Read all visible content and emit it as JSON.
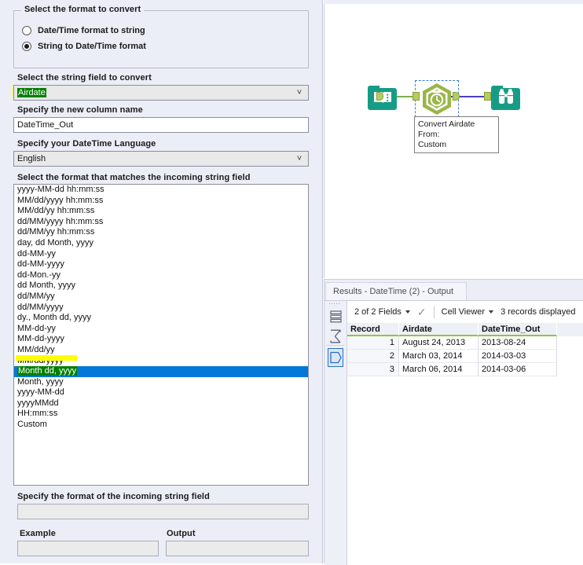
{
  "config_panel": {
    "format_group": {
      "title": "Select the format to convert",
      "options": [
        {
          "label": "Date/Time format to string",
          "checked": false
        },
        {
          "label": "String to Date/Time format",
          "checked": true
        }
      ]
    },
    "string_field": {
      "label": "Select the string field to convert",
      "value": "Airdate"
    },
    "new_column": {
      "label": "Specify the new column name",
      "value": "DateTime_Out"
    },
    "language": {
      "label": "Specify your DateTime Language",
      "value": "English"
    },
    "format_list": {
      "label": "Select the format that matches the incoming string field",
      "selected": "Month dd, yyyy",
      "items": [
        "yyyy-MM-dd hh:mm:ss",
        "MM/dd/yyyy hh:mm:ss",
        "MM/dd/yy hh:mm:ss",
        "dd/MM/yyyy hh:mm:ss",
        "dd/MM/yy hh:mm:ss",
        "day, dd Month, yyyy",
        "dd-MM-yy",
        "dd-MM-yyyy",
        "dd-Mon.-yy",
        "dd Month, yyyy",
        "dd/MM/yy",
        "dd/MM/yyyy",
        "dy., Month dd, yyyy",
        "MM-dd-yy",
        "MM-dd-yyyy",
        "MM/dd/yy",
        "MM/dd/yyyy",
        "Month dd, yyyy",
        "Month, yyyy",
        "yyyy-MM-dd",
        "yyyyMMdd",
        "HH:mm:ss",
        "Custom"
      ]
    },
    "custom_format": {
      "label": "Specify the format of the incoming string field",
      "value": ""
    },
    "example": {
      "label": "Example",
      "value": ""
    },
    "output": {
      "label": "Output",
      "value": ""
    }
  },
  "canvas": {
    "tools": [
      {
        "name": "input-data-tool",
        "icon": "book-icon"
      },
      {
        "name": "datetime-tool",
        "icon": "clock-hexagon-icon"
      },
      {
        "name": "browse-tool",
        "icon": "binoculars-icon"
      }
    ],
    "annotation": {
      "line1": "Convert Airdate",
      "line2": "From:",
      "line3": "Custom"
    }
  },
  "results": {
    "tab_title": "Results - DateTime (2) - Output",
    "toolbar": {
      "fields": "2 of 2 Fields",
      "viewer": "Cell Viewer",
      "records": "3 records displayed"
    },
    "grid": {
      "columns": [
        "Record",
        "Airdate",
        "DateTime_Out"
      ],
      "rows": [
        [
          "1",
          "August 24, 2013",
          "2013-08-24"
        ],
        [
          "2",
          "March 03, 2014",
          "2014-03-03"
        ],
        [
          "3",
          "March 06, 2014",
          "2014-03-06"
        ]
      ]
    }
  },
  "colors": {
    "panel_bg": "#eceef7",
    "selection_blue": "#0078d7",
    "highlight_yellow": "#ffff00",
    "selection_green": "#008000",
    "tool_teal": "#169c86",
    "tool_olive": "#9ab648",
    "grid_accent_green": "#8dc63f"
  }
}
